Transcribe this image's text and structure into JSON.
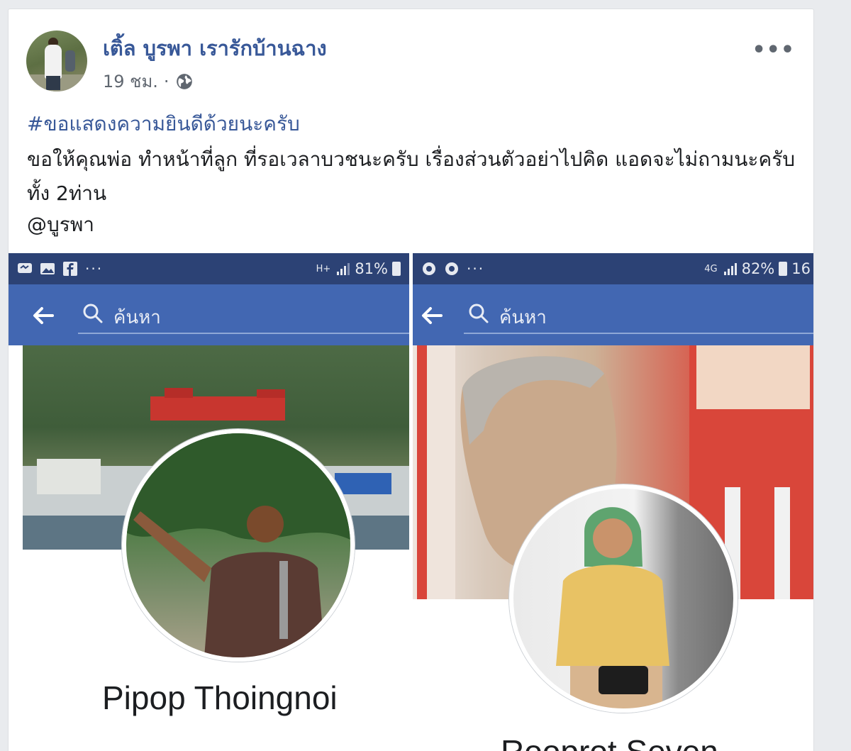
{
  "post": {
    "author": "เติ้ล บูรพา เรารักบ้านฉาง",
    "time": "19 ชม.",
    "separator": "·",
    "more_label": "•••",
    "hashtag": "#ขอแสดงความยินดีด้วยนะครับ",
    "body": "ขอให้คุณพ่อ ทำหน้าที่ลูก ที่รอเวลาบวชนะครับ เรื่องส่วนตัวอย่าไปคิด แอดจะไม่ถามนะครับ ทั้ง 2ท่าน",
    "mention": "@บูรพา"
  },
  "screenshots": [
    {
      "status_network": "H+",
      "status_battery": "81%",
      "status_time": "",
      "search_placeholder": "ค้นหา",
      "profile_name": "Pipop Thoingnoi"
    },
    {
      "status_network": "4G",
      "status_battery": "82%",
      "status_time": "16",
      "search_placeholder": "ค้นหา",
      "profile_name": "Rooprot Seven"
    }
  ],
  "colors": {
    "facebook_blue": "#4267b2",
    "status_bar": "#2c4275",
    "link_blue": "#385898"
  }
}
